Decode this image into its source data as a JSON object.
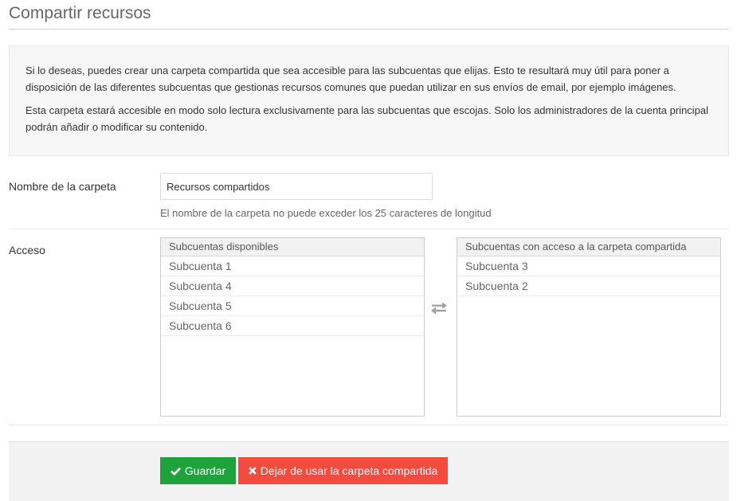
{
  "page": {
    "title": "Compartir recursos"
  },
  "info": {
    "paragraph_1": "Si lo deseas, puedes crear una carpeta compartida que sea accesible para las subcuentas que elijas. Esto te resultará muy útil para poner a disposición de las diferentes subcuentas que gestionas recursos comunes que puedan utilizar en sus envíos de email, por ejemplo imágenes.",
    "paragraph_2": "Esta carpeta estará accesible en modo solo lectura exclusivamente para las subcuentas que escojas. Solo los administradores de la cuenta principal podrán añadir o modificar su contenido."
  },
  "folder": {
    "label": "Nombre de la carpeta",
    "value": "Recursos compartidos",
    "help": "El nombre de la carpeta no puede exceder los 25 caracteres de longitud"
  },
  "access": {
    "label": "Acceso",
    "available": {
      "header": "Subcuentas disponibles",
      "items": [
        "Subcuenta 1",
        "Subcuenta 4",
        "Subcuenta 5",
        "Subcuenta 6"
      ]
    },
    "selected": {
      "header": "Subcuentas con acceso a la carpeta compartida",
      "items": [
        "Subcuenta 3",
        "Subcuenta 2"
      ]
    },
    "swap_icon": "exchange-arrows-icon"
  },
  "actions": {
    "save_label": "Guardar",
    "save_icon": "check-icon",
    "save_color": "#1ea33c",
    "stop_label": "Dejar de usar la carpeta compartida",
    "stop_icon": "close-icon",
    "stop_color": "#f14c3e"
  }
}
